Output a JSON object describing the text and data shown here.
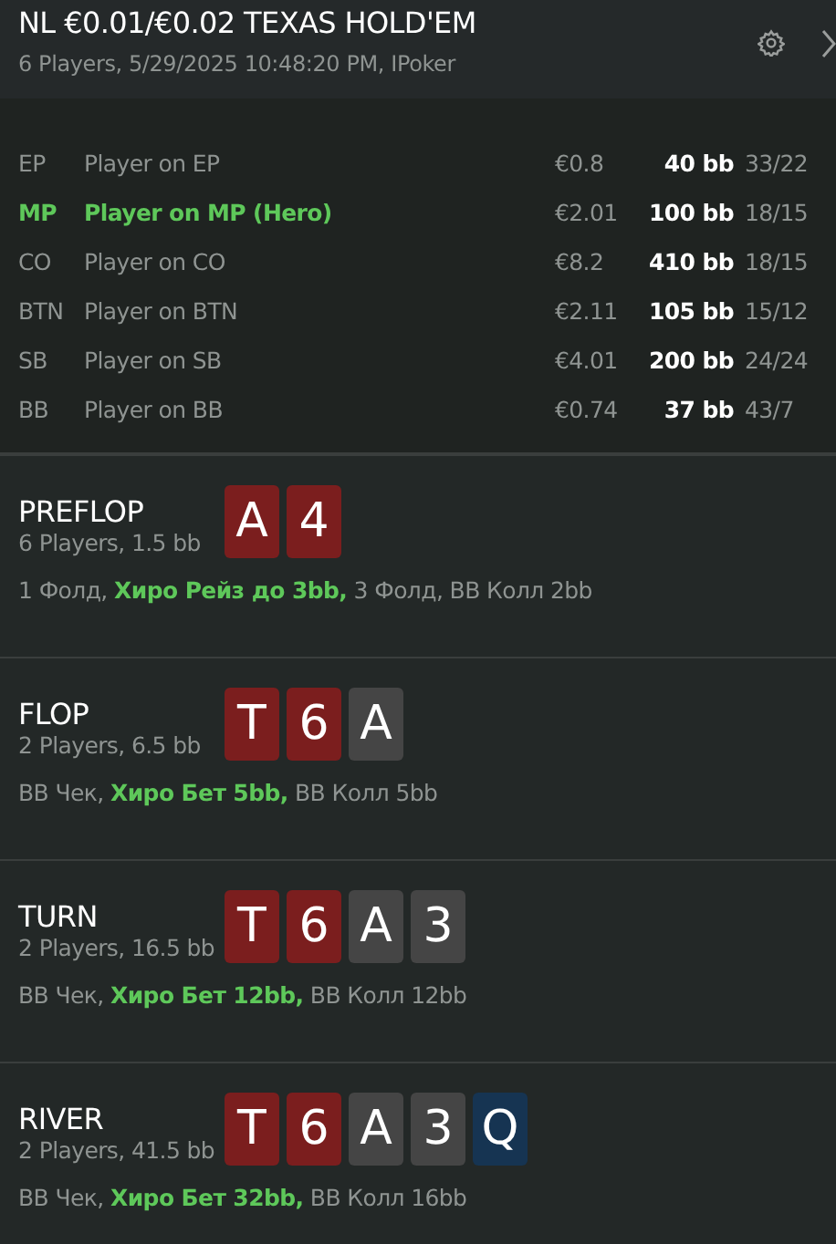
{
  "header": {
    "title": "NL €0.01/€0.02 TEXAS HOLD'EM",
    "subtitle": "6 Players, 5/29/2025 10:48:20 PM, IPoker"
  },
  "players": [
    {
      "position": "EP",
      "name": "Player on EP",
      "stack": "€0.8",
      "bb": "40 bb",
      "stats": "33/22",
      "hero": false
    },
    {
      "position": "MP",
      "name": "Player on MP (Hero)",
      "stack": "€2.01",
      "bb": "100 bb",
      "stats": "18/15",
      "hero": true
    },
    {
      "position": "CO",
      "name": "Player on CO",
      "stack": "€8.2",
      "bb": "410 bb",
      "stats": "18/15",
      "hero": false
    },
    {
      "position": "BTN",
      "name": "Player on BTN",
      "stack": "€2.11",
      "bb": "105 bb",
      "stats": "15/12",
      "hero": false
    },
    {
      "position": "SB",
      "name": "Player on SB",
      "stack": "€4.01",
      "bb": "200 bb",
      "stats": "24/24",
      "hero": false
    },
    {
      "position": "BB",
      "name": "Player on BB",
      "stack": "€0.74",
      "bb": "37 bb",
      "stats": "43/7",
      "hero": false
    }
  ],
  "streets": [
    {
      "name": "PREFLOP",
      "info": "6 Players, 1.5 bb",
      "cards": [
        {
          "rank": "A",
          "color": "#7b1e1e"
        },
        {
          "rank": "4",
          "color": "#7b1e1e"
        }
      ],
      "actions": [
        {
          "text": "1 Фолд,",
          "hero": false
        },
        {
          "text": "Хиро Рейз до 3bb,",
          "hero": true
        },
        {
          "text": "3 Фолд, BB Колл 2bb",
          "hero": false
        }
      ]
    },
    {
      "name": "FLOP",
      "info": "2 Players, 6.5 bb",
      "cards": [
        {
          "rank": "T",
          "color": "#7b1e1e"
        },
        {
          "rank": "6",
          "color": "#7b1e1e"
        },
        {
          "rank": "A",
          "color": "#454545"
        }
      ],
      "actions": [
        {
          "text": "BB Чек,",
          "hero": false
        },
        {
          "text": "Хиро Бет 5bb,",
          "hero": true
        },
        {
          "text": "BB Колл 5bb",
          "hero": false
        }
      ]
    },
    {
      "name": "TURN",
      "info": "2 Players, 16.5 bb",
      "cards": [
        {
          "rank": "T",
          "color": "#7b1e1e"
        },
        {
          "rank": "6",
          "color": "#7b1e1e"
        },
        {
          "rank": "A",
          "color": "#454545"
        },
        {
          "rank": "3",
          "color": "#454545"
        }
      ],
      "actions": [
        {
          "text": "BB Чек,",
          "hero": false
        },
        {
          "text": "Хиро Бет 12bb,",
          "hero": true
        },
        {
          "text": "BB Колл 12bb",
          "hero": false
        }
      ]
    },
    {
      "name": "RIVER",
      "info": "2 Players, 41.5 bb",
      "cards": [
        {
          "rank": "T",
          "color": "#7b1e1e"
        },
        {
          "rank": "6",
          "color": "#7b1e1e"
        },
        {
          "rank": "A",
          "color": "#454545"
        },
        {
          "rank": "3",
          "color": "#454545"
        },
        {
          "rank": "Q",
          "color": "#163452"
        }
      ],
      "actions": [
        {
          "text": "BB Чек,",
          "hero": false
        },
        {
          "text": "Хиро Бет 32bb,",
          "hero": true
        },
        {
          "text": "BB Колл 16bb",
          "hero": false
        }
      ]
    }
  ]
}
